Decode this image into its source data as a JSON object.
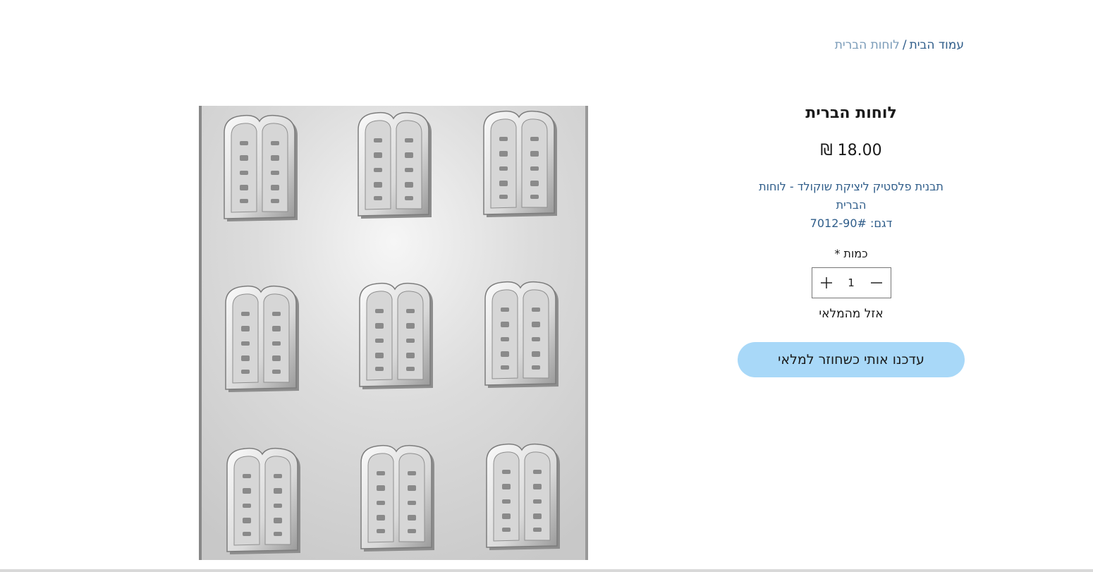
{
  "breadcrumb": {
    "home": "עמוד הבית",
    "separator": "/",
    "current": "לוחות הברית"
  },
  "product": {
    "image_alt": "תבנית לוחות הברית",
    "title": "לוחות הברית",
    "price": "18.00 ₪",
    "description": "תבנית פלסטיק ליציקת שוקולד - לוחות הברית",
    "sku": "דגם: 7012-90#"
  },
  "quantity": {
    "label": "כמות *",
    "value": "1",
    "decrease_icon": "minus-icon",
    "increase_icon": "plus-icon"
  },
  "stock_status": "אזל מהמלאי",
  "notify_button": "עדכנו אותי כשחוזר למלאי",
  "colors": {
    "link": "#2f5d8a",
    "breadcrumb_current": "#7a9bb8",
    "notify_bg": "#a8d8f8"
  }
}
